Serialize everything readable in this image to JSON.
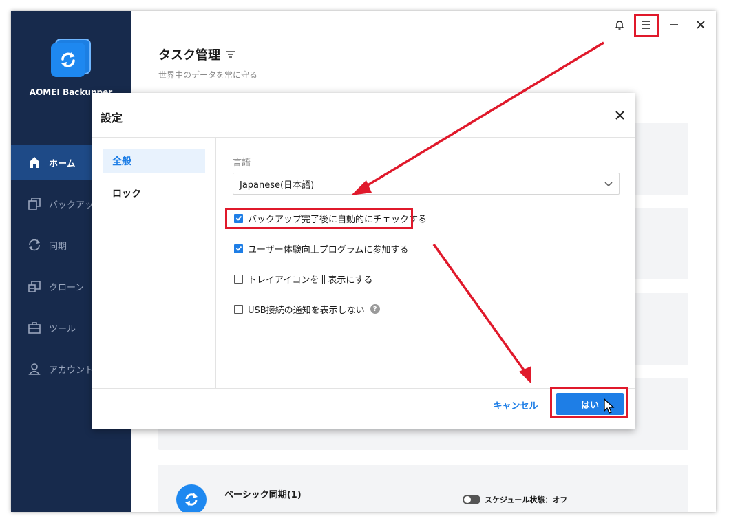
{
  "app": {
    "name": "AOMEI Backupper"
  },
  "sidebar": {
    "items": [
      {
        "label": "ホーム",
        "icon": "home-icon"
      },
      {
        "label": "バックアップ",
        "icon": "backup-icon"
      },
      {
        "label": "同期",
        "icon": "sync-icon"
      },
      {
        "label": "クローン",
        "icon": "clone-icon"
      },
      {
        "label": "ツール",
        "icon": "tools-icon"
      },
      {
        "label": "アカウント",
        "icon": "account-icon"
      }
    ]
  },
  "header": {
    "title": "タスク管理",
    "subtitle": "世界中のデータを常に守る"
  },
  "task": {
    "name": "ベーシック同期(1)",
    "schedule": "スケジュール状態：オフ"
  },
  "dialog": {
    "title": "設定",
    "tabs": [
      {
        "label": "全般"
      },
      {
        "label": "ロック"
      }
    ],
    "language_label": "言語",
    "language_value": "Japanese(日本語)",
    "options": [
      {
        "label": "バックアップ完了後に自動的にチェックする",
        "checked": true
      },
      {
        "label": "ユーザー体験向上プログラムに参加する",
        "checked": true
      },
      {
        "label": "トレイアイコンを非表示にする",
        "checked": false
      },
      {
        "label": "USB接続の通知を表示しない",
        "checked": false
      }
    ],
    "help_glyph": "?",
    "cancel_label": "キャンセル",
    "ok_label": "はい"
  },
  "colors": {
    "sidebar_bg": "#172a4c",
    "sidebar_active": "#1e4a87",
    "accent": "#1e7ee6",
    "annotation_red": "#e0192b"
  }
}
